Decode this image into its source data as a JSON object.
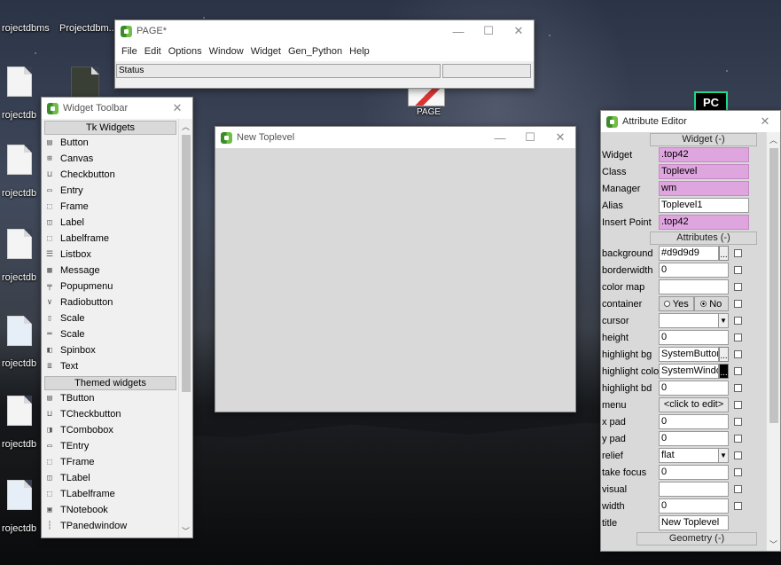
{
  "desktop": {
    "labels": [
      "rojectdbms",
      "Projectdbm...",
      "rojectdb",
      "rojectdb",
      "rojectdb",
      "rojectdb",
      "rojectdb",
      "rojectdb",
      "PAGE"
    ]
  },
  "page_window": {
    "title": "PAGE*",
    "menu": [
      "File",
      "Edit",
      "Options",
      "Window",
      "Widget",
      "Gen_Python",
      "Help"
    ],
    "status": "Status"
  },
  "widget_toolbar": {
    "title": "Widget Toolbar",
    "sections": [
      "Tk Widgets",
      "Themed widgets"
    ],
    "tk_items": [
      "Button",
      "Canvas",
      "Checkbutton",
      "Entry",
      "Frame",
      "Label",
      "Labelframe",
      "Listbox",
      "Message",
      "Popupmenu",
      "Radiobutton",
      "Scale",
      "Scale",
      "Spinbox",
      "Text"
    ],
    "themed_items": [
      "TButton",
      "TCheckbutton",
      "TCombobox",
      "TEntry",
      "TFrame",
      "TLabel",
      "TLabelframe",
      "TNotebook",
      "TPanedwindow"
    ]
  },
  "toplevel": {
    "title": "New Toplevel"
  },
  "attribute_editor": {
    "title": "Attribute Editor",
    "widget_section": "Widget (-)",
    "widget_rows": [
      {
        "label": "Widget",
        "value": ".top42"
      },
      {
        "label": "Class",
        "value": "Toplevel"
      },
      {
        "label": "Manager",
        "value": "wm"
      },
      {
        "label": "Alias",
        "value": "Toplevel1"
      },
      {
        "label": "Insert Point",
        "value": ".top42"
      }
    ],
    "attributes_section": "Attributes (-)",
    "attr_rows": [
      {
        "label": "background",
        "value": "#d9d9d9"
      },
      {
        "label": "borderwidth",
        "value": "0"
      },
      {
        "label": "color map",
        "value": ""
      },
      {
        "label": "container",
        "yes": "Yes",
        "no": "No"
      },
      {
        "label": "cursor",
        "value": ""
      },
      {
        "label": "height",
        "value": "0"
      },
      {
        "label": "highlight bg",
        "value": "SystemButtonF"
      },
      {
        "label": "highlight colo",
        "value": "SystemWindov"
      },
      {
        "label": "highlight bd",
        "value": "0"
      },
      {
        "label": "menu",
        "value": "<click to edit>"
      },
      {
        "label": "x pad",
        "value": "0"
      },
      {
        "label": "y pad",
        "value": "0"
      },
      {
        "label": "relief",
        "value": "flat"
      },
      {
        "label": "take focus",
        "value": "0"
      },
      {
        "label": "visual",
        "value": ""
      },
      {
        "label": "width",
        "value": "0"
      },
      {
        "label": "title",
        "value": "New Toplevel"
      }
    ],
    "geometry_section": "Geometry (-)"
  },
  "pycharm_icon": {
    "text": "PC"
  },
  "colors": {
    "pink_field": "#dfa5df",
    "canvas_bg": "#d9d9d9",
    "accent_green": "#21d789"
  }
}
